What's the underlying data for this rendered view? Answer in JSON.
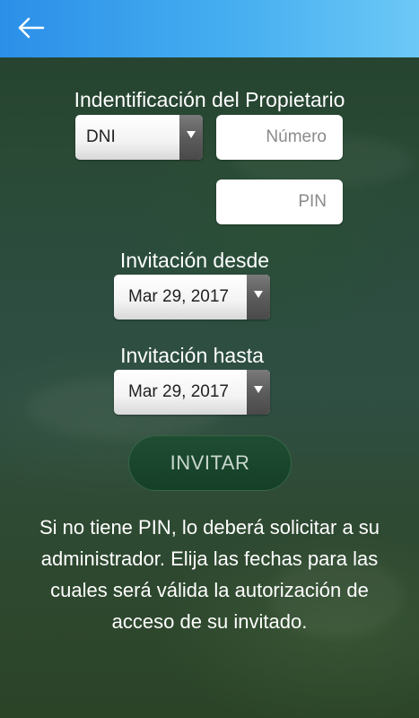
{
  "header": {
    "back_icon": "arrow-left-icon",
    "colors": {
      "start": "#2b8fe8",
      "end": "#6cc8f6"
    }
  },
  "form": {
    "owner_id_label": "Indentificación del Propietario",
    "doc_type": {
      "selected": "DNI",
      "icon": "triangle-down-icon"
    },
    "number_placeholder": "Número",
    "pin_placeholder": "PIN",
    "from_label": "Invitación desde",
    "from_date": "Mar 29, 2017",
    "to_label": "Invitación hasta",
    "to_date": "Mar 29, 2017",
    "submit_label": "INVITAR",
    "help_text": "Si no tiene PIN, lo deberá solicitar a su administrador. Elija las fechas para las cuales será válida la autorización de acceso de su invitado."
  }
}
